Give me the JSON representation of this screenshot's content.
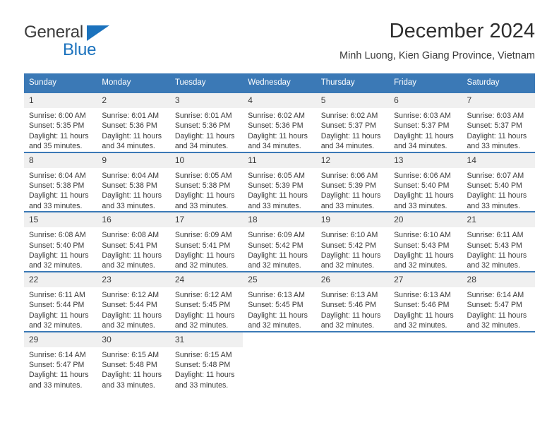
{
  "brand": {
    "name_top": "General",
    "name_bottom": "Blue",
    "accent_color": "#1b72bd"
  },
  "header": {
    "title": "December 2024",
    "subtitle": "Minh Luong, Kien Giang Province, Vietnam"
  },
  "theme": {
    "header_blue": "#3b79b6",
    "daynum_band": "#f0f0f0",
    "text": "#3a3a3a"
  },
  "weekday_headers": [
    "Sunday",
    "Monday",
    "Tuesday",
    "Wednesday",
    "Thursday",
    "Friday",
    "Saturday"
  ],
  "weeks": [
    [
      {
        "day": "1",
        "sunrise": "Sunrise: 6:00 AM",
        "sunset": "Sunset: 5:35 PM",
        "daylight_1": "Daylight: 11 hours",
        "daylight_2": "and 35 minutes."
      },
      {
        "day": "2",
        "sunrise": "Sunrise: 6:01 AM",
        "sunset": "Sunset: 5:36 PM",
        "daylight_1": "Daylight: 11 hours",
        "daylight_2": "and 34 minutes."
      },
      {
        "day": "3",
        "sunrise": "Sunrise: 6:01 AM",
        "sunset": "Sunset: 5:36 PM",
        "daylight_1": "Daylight: 11 hours",
        "daylight_2": "and 34 minutes."
      },
      {
        "day": "4",
        "sunrise": "Sunrise: 6:02 AM",
        "sunset": "Sunset: 5:36 PM",
        "daylight_1": "Daylight: 11 hours",
        "daylight_2": "and 34 minutes."
      },
      {
        "day": "5",
        "sunrise": "Sunrise: 6:02 AM",
        "sunset": "Sunset: 5:37 PM",
        "daylight_1": "Daylight: 11 hours",
        "daylight_2": "and 34 minutes."
      },
      {
        "day": "6",
        "sunrise": "Sunrise: 6:03 AM",
        "sunset": "Sunset: 5:37 PM",
        "daylight_1": "Daylight: 11 hours",
        "daylight_2": "and 34 minutes."
      },
      {
        "day": "7",
        "sunrise": "Sunrise: 6:03 AM",
        "sunset": "Sunset: 5:37 PM",
        "daylight_1": "Daylight: 11 hours",
        "daylight_2": "and 33 minutes."
      }
    ],
    [
      {
        "day": "8",
        "sunrise": "Sunrise: 6:04 AM",
        "sunset": "Sunset: 5:38 PM",
        "daylight_1": "Daylight: 11 hours",
        "daylight_2": "and 33 minutes."
      },
      {
        "day": "9",
        "sunrise": "Sunrise: 6:04 AM",
        "sunset": "Sunset: 5:38 PM",
        "daylight_1": "Daylight: 11 hours",
        "daylight_2": "and 33 minutes."
      },
      {
        "day": "10",
        "sunrise": "Sunrise: 6:05 AM",
        "sunset": "Sunset: 5:38 PM",
        "daylight_1": "Daylight: 11 hours",
        "daylight_2": "and 33 minutes."
      },
      {
        "day": "11",
        "sunrise": "Sunrise: 6:05 AM",
        "sunset": "Sunset: 5:39 PM",
        "daylight_1": "Daylight: 11 hours",
        "daylight_2": "and 33 minutes."
      },
      {
        "day": "12",
        "sunrise": "Sunrise: 6:06 AM",
        "sunset": "Sunset: 5:39 PM",
        "daylight_1": "Daylight: 11 hours",
        "daylight_2": "and 33 minutes."
      },
      {
        "day": "13",
        "sunrise": "Sunrise: 6:06 AM",
        "sunset": "Sunset: 5:40 PM",
        "daylight_1": "Daylight: 11 hours",
        "daylight_2": "and 33 minutes."
      },
      {
        "day": "14",
        "sunrise": "Sunrise: 6:07 AM",
        "sunset": "Sunset: 5:40 PM",
        "daylight_1": "Daylight: 11 hours",
        "daylight_2": "and 33 minutes."
      }
    ],
    [
      {
        "day": "15",
        "sunrise": "Sunrise: 6:08 AM",
        "sunset": "Sunset: 5:40 PM",
        "daylight_1": "Daylight: 11 hours",
        "daylight_2": "and 32 minutes."
      },
      {
        "day": "16",
        "sunrise": "Sunrise: 6:08 AM",
        "sunset": "Sunset: 5:41 PM",
        "daylight_1": "Daylight: 11 hours",
        "daylight_2": "and 32 minutes."
      },
      {
        "day": "17",
        "sunrise": "Sunrise: 6:09 AM",
        "sunset": "Sunset: 5:41 PM",
        "daylight_1": "Daylight: 11 hours",
        "daylight_2": "and 32 minutes."
      },
      {
        "day": "18",
        "sunrise": "Sunrise: 6:09 AM",
        "sunset": "Sunset: 5:42 PM",
        "daylight_1": "Daylight: 11 hours",
        "daylight_2": "and 32 minutes."
      },
      {
        "day": "19",
        "sunrise": "Sunrise: 6:10 AM",
        "sunset": "Sunset: 5:42 PM",
        "daylight_1": "Daylight: 11 hours",
        "daylight_2": "and 32 minutes."
      },
      {
        "day": "20",
        "sunrise": "Sunrise: 6:10 AM",
        "sunset": "Sunset: 5:43 PM",
        "daylight_1": "Daylight: 11 hours",
        "daylight_2": "and 32 minutes."
      },
      {
        "day": "21",
        "sunrise": "Sunrise: 6:11 AM",
        "sunset": "Sunset: 5:43 PM",
        "daylight_1": "Daylight: 11 hours",
        "daylight_2": "and 32 minutes."
      }
    ],
    [
      {
        "day": "22",
        "sunrise": "Sunrise: 6:11 AM",
        "sunset": "Sunset: 5:44 PM",
        "daylight_1": "Daylight: 11 hours",
        "daylight_2": "and 32 minutes."
      },
      {
        "day": "23",
        "sunrise": "Sunrise: 6:12 AM",
        "sunset": "Sunset: 5:44 PM",
        "daylight_1": "Daylight: 11 hours",
        "daylight_2": "and 32 minutes."
      },
      {
        "day": "24",
        "sunrise": "Sunrise: 6:12 AM",
        "sunset": "Sunset: 5:45 PM",
        "daylight_1": "Daylight: 11 hours",
        "daylight_2": "and 32 minutes."
      },
      {
        "day": "25",
        "sunrise": "Sunrise: 6:13 AM",
        "sunset": "Sunset: 5:45 PM",
        "daylight_1": "Daylight: 11 hours",
        "daylight_2": "and 32 minutes."
      },
      {
        "day": "26",
        "sunrise": "Sunrise: 6:13 AM",
        "sunset": "Sunset: 5:46 PM",
        "daylight_1": "Daylight: 11 hours",
        "daylight_2": "and 32 minutes."
      },
      {
        "day": "27",
        "sunrise": "Sunrise: 6:13 AM",
        "sunset": "Sunset: 5:46 PM",
        "daylight_1": "Daylight: 11 hours",
        "daylight_2": "and 32 minutes."
      },
      {
        "day": "28",
        "sunrise": "Sunrise: 6:14 AM",
        "sunset": "Sunset: 5:47 PM",
        "daylight_1": "Daylight: 11 hours",
        "daylight_2": "and 32 minutes."
      }
    ],
    [
      {
        "day": "29",
        "sunrise": "Sunrise: 6:14 AM",
        "sunset": "Sunset: 5:47 PM",
        "daylight_1": "Daylight: 11 hours",
        "daylight_2": "and 33 minutes."
      },
      {
        "day": "30",
        "sunrise": "Sunrise: 6:15 AM",
        "sunset": "Sunset: 5:48 PM",
        "daylight_1": "Daylight: 11 hours",
        "daylight_2": "and 33 minutes."
      },
      {
        "day": "31",
        "sunrise": "Sunrise: 6:15 AM",
        "sunset": "Sunset: 5:48 PM",
        "daylight_1": "Daylight: 11 hours",
        "daylight_2": "and 33 minutes."
      },
      {
        "day": "",
        "sunrise": "",
        "sunset": "",
        "daylight_1": "",
        "daylight_2": ""
      },
      {
        "day": "",
        "sunrise": "",
        "sunset": "",
        "daylight_1": "",
        "daylight_2": ""
      },
      {
        "day": "",
        "sunrise": "",
        "sunset": "",
        "daylight_1": "",
        "daylight_2": ""
      },
      {
        "day": "",
        "sunrise": "",
        "sunset": "",
        "daylight_1": "",
        "daylight_2": ""
      }
    ]
  ]
}
